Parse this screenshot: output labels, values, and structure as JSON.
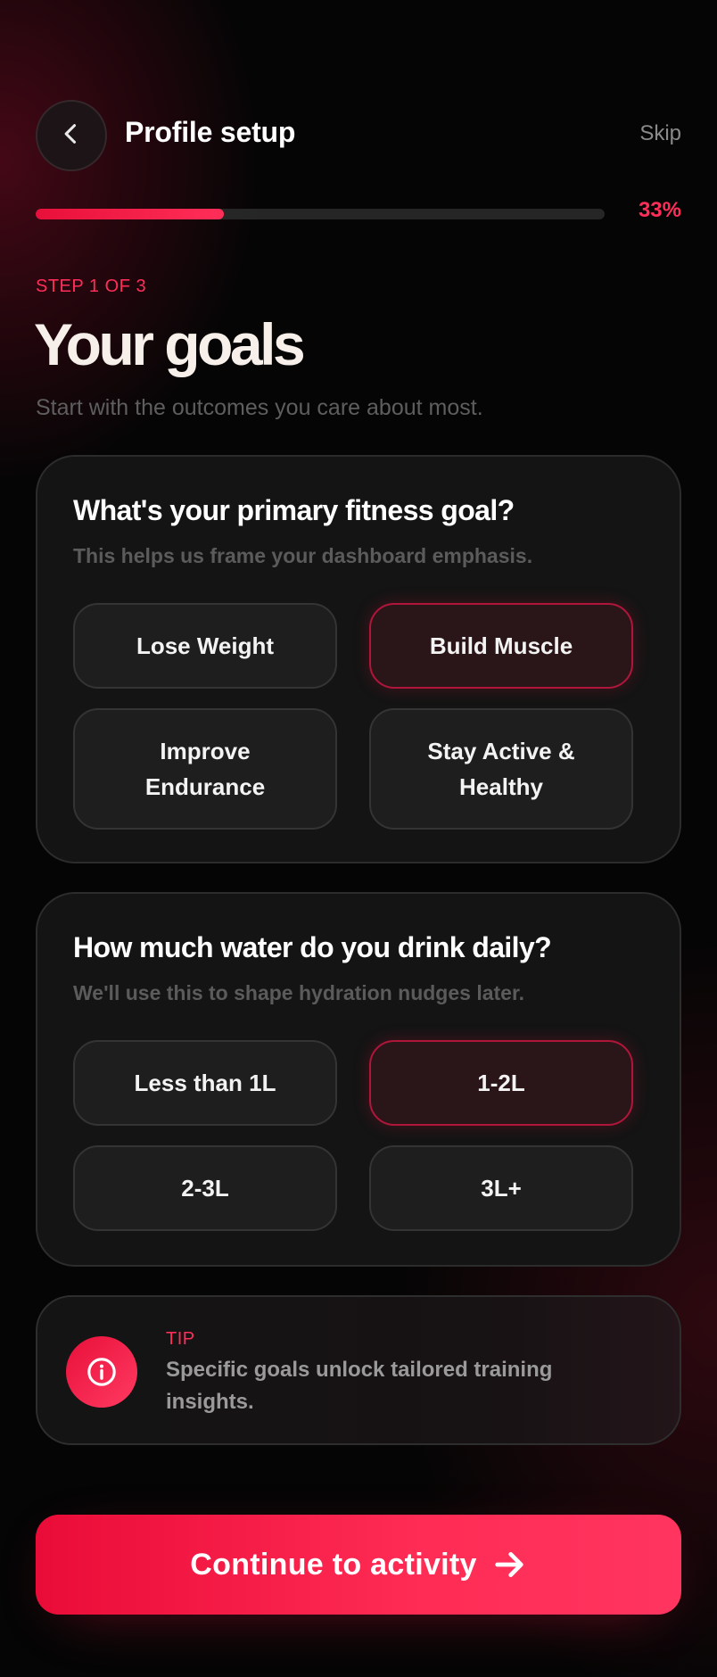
{
  "header": {
    "title": "Profile setup",
    "skip_label": "Skip"
  },
  "progress": {
    "value_percent": 33,
    "label": "33%"
  },
  "step": {
    "label": "STEP 1 OF 3",
    "title": "Your goals",
    "subtitle": "Start with the outcomes you care about most."
  },
  "fitness_goal": {
    "question": "What's your primary fitness goal?",
    "hint": "This helps us frame your dashboard emphasis.",
    "selected": "Build Muscle",
    "options": [
      {
        "label": "Lose Weight",
        "selected": false
      },
      {
        "label": "Build Muscle",
        "selected": true
      },
      {
        "label": "Improve Endurance",
        "selected": false
      },
      {
        "label": "Stay Active & Healthy",
        "selected": false
      }
    ]
  },
  "water": {
    "question": "How much water do you drink daily?",
    "hint": "We'll use this to shape hydration nudges later.",
    "selected": "1-2L",
    "options": [
      {
        "label": "Less than 1L",
        "selected": false
      },
      {
        "label": "1-2L",
        "selected": true
      },
      {
        "label": "2-3L",
        "selected": false
      },
      {
        "label": "3L+",
        "selected": false
      }
    ]
  },
  "tip": {
    "label": "TIP",
    "text": "Specific goals unlock tailored training insights.",
    "icon": "info-icon"
  },
  "cta": {
    "label": "Continue to activity",
    "icon": "arrow-right-icon"
  },
  "colors": {
    "accent": "#ff2e58",
    "accent_deep": "#e8103a",
    "background": "#050505",
    "card": "#141414",
    "selected_border": "#b0163a"
  }
}
